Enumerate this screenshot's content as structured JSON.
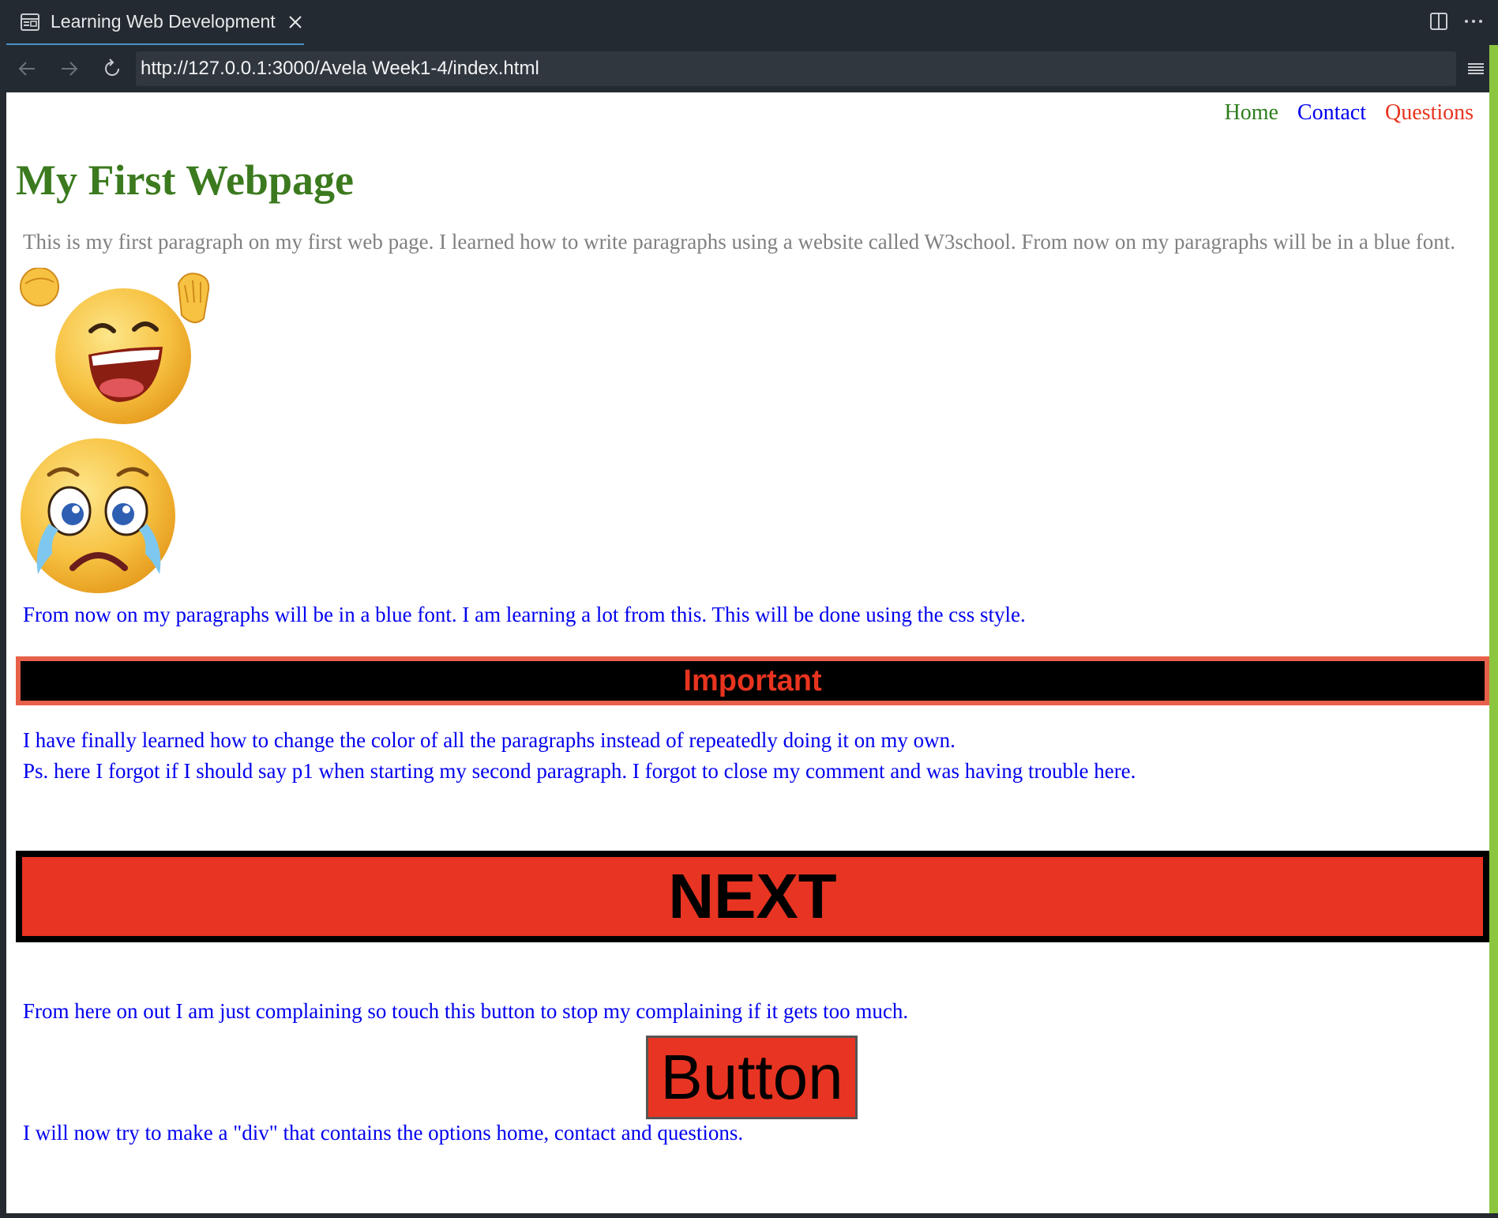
{
  "browser": {
    "tab_title": "Learning Web Development",
    "url": "http://127.0.0.1:3000/Avela Week1-4/index.html"
  },
  "page": {
    "nav": [
      {
        "label": "Home",
        "color": "#2e7d1e"
      },
      {
        "label": "Contact",
        "color": "#0000ee"
      },
      {
        "label": "Questions",
        "color": "#e8341f"
      }
    ],
    "heading": "My First Webpage",
    "intro_paragraph": "This is my first paragraph on my first web page. I learned how to write paragraphs using a website called W3school. From now on my paragraphs will be in a blue font.",
    "emojis": [
      "laughing-emoji",
      "crying-emoji"
    ],
    "blue_paragraph": "From now on my paragraphs will be in a blue font. I am learning a lot from this. This will be done using the css style.",
    "important_label": "Important",
    "learned_paragraph": "I have finally learned how to change the color of all the paragraphs instead of repeatedly doing it on my own.",
    "ps_paragraph": "Ps. here I forgot if I should say p1 when starting my second paragraph. I forgot to close my comment and was having trouble here.",
    "next_label": "NEXT",
    "complaining_paragraph": "From here on out I am just complaining so touch this button to stop my complaining if it gets too much.",
    "button_label": "Button",
    "div_paragraph": "I will now try to make a \"div\" that contains the options home, contact and questions."
  }
}
